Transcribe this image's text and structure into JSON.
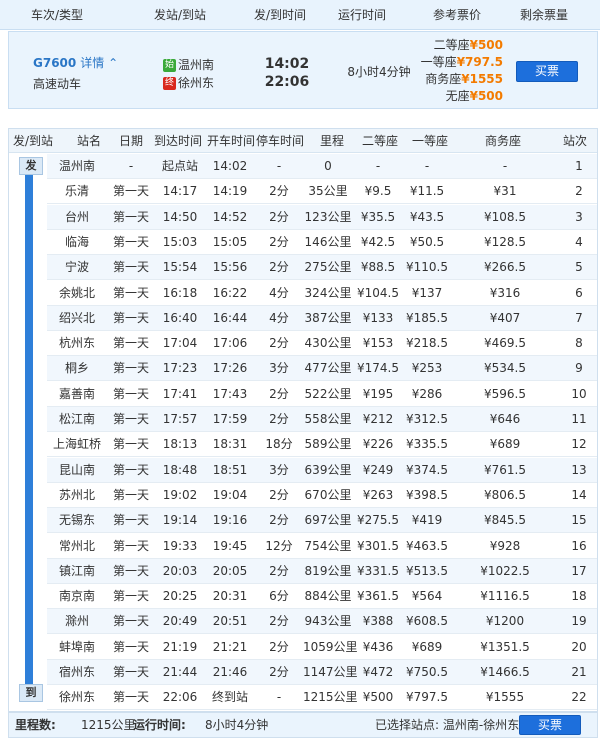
{
  "header": {
    "cols": [
      "车次/类型",
      "发站/到站",
      "发/到时间",
      "运行时间",
      "参考票价",
      "剩余票量"
    ]
  },
  "train": {
    "number": "G7600",
    "detail_link": "详情",
    "type": "高速动车",
    "from_tag": "始",
    "from": "温州南",
    "to_tag": "终",
    "to": "徐州东",
    "depart": "14:02",
    "arrive": "22:06",
    "duration": "8小时4分钟",
    "prices": [
      {
        "label": "二等座",
        "value": "¥500"
      },
      {
        "label": "一等座",
        "value": "¥797.5"
      },
      {
        "label": "商务座",
        "value": "¥1555"
      },
      {
        "label": "无座",
        "value": "¥500"
      }
    ],
    "buy": "买票",
    "tag_colors": {
      "from": "#3aa93a",
      "to": "#d9281e"
    }
  },
  "table": {
    "headers": [
      "发/到站",
      "站名",
      "日期",
      "到达时间",
      "开车时间",
      "停车时间",
      "里程",
      "二等座",
      "一等座",
      "商务座",
      "站次"
    ],
    "depart_badge": "发",
    "arrive_badge": "到",
    "rows": [
      [
        "温州南",
        "-",
        "起点站",
        "14:02",
        "-",
        "0",
        "-",
        "-",
        "-",
        "1"
      ],
      [
        "乐清",
        "第一天",
        "14:17",
        "14:19",
        "2分",
        "35公里",
        "¥9.5",
        "¥11.5",
        "¥31",
        "2"
      ],
      [
        "台州",
        "第一天",
        "14:50",
        "14:52",
        "2分",
        "123公里",
        "¥35.5",
        "¥43.5",
        "¥108.5",
        "3"
      ],
      [
        "临海",
        "第一天",
        "15:03",
        "15:05",
        "2分",
        "146公里",
        "¥42.5",
        "¥50.5",
        "¥128.5",
        "4"
      ],
      [
        "宁波",
        "第一天",
        "15:54",
        "15:56",
        "2分",
        "275公里",
        "¥88.5",
        "¥110.5",
        "¥266.5",
        "5"
      ],
      [
        "余姚北",
        "第一天",
        "16:18",
        "16:22",
        "4分",
        "324公里",
        "¥104.5",
        "¥137",
        "¥316",
        "6"
      ],
      [
        "绍兴北",
        "第一天",
        "16:40",
        "16:44",
        "4分",
        "387公里",
        "¥133",
        "¥185.5",
        "¥407",
        "7"
      ],
      [
        "杭州东",
        "第一天",
        "17:04",
        "17:06",
        "2分",
        "430公里",
        "¥153",
        "¥218.5",
        "¥469.5",
        "8"
      ],
      [
        "桐乡",
        "第一天",
        "17:23",
        "17:26",
        "3分",
        "477公里",
        "¥174.5",
        "¥253",
        "¥534.5",
        "9"
      ],
      [
        "嘉善南",
        "第一天",
        "17:41",
        "17:43",
        "2分",
        "522公里",
        "¥195",
        "¥286",
        "¥596.5",
        "10"
      ],
      [
        "松江南",
        "第一天",
        "17:57",
        "17:59",
        "2分",
        "558公里",
        "¥212",
        "¥312.5",
        "¥646",
        "11"
      ],
      [
        "上海虹桥",
        "第一天",
        "18:13",
        "18:31",
        "18分",
        "589公里",
        "¥226",
        "¥335.5",
        "¥689",
        "12"
      ],
      [
        "昆山南",
        "第一天",
        "18:48",
        "18:51",
        "3分",
        "639公里",
        "¥249",
        "¥374.5",
        "¥761.5",
        "13"
      ],
      [
        "苏州北",
        "第一天",
        "19:02",
        "19:04",
        "2分",
        "670公里",
        "¥263",
        "¥398.5",
        "¥806.5",
        "14"
      ],
      [
        "无锡东",
        "第一天",
        "19:14",
        "19:16",
        "2分",
        "697公里",
        "¥275.5",
        "¥419",
        "¥845.5",
        "15"
      ],
      [
        "常州北",
        "第一天",
        "19:33",
        "19:45",
        "12分",
        "754公里",
        "¥301.5",
        "¥463.5",
        "¥928",
        "16"
      ],
      [
        "镇江南",
        "第一天",
        "20:03",
        "20:05",
        "2分",
        "819公里",
        "¥331.5",
        "¥513.5",
        "¥1022.5",
        "17"
      ],
      [
        "南京南",
        "第一天",
        "20:25",
        "20:31",
        "6分",
        "884公里",
        "¥361.5",
        "¥564",
        "¥1116.5",
        "18"
      ],
      [
        "滁州",
        "第一天",
        "20:49",
        "20:51",
        "2分",
        "943公里",
        "¥388",
        "¥608.5",
        "¥1200",
        "19"
      ],
      [
        "蚌埠南",
        "第一天",
        "21:19",
        "21:21",
        "2分",
        "1059公里",
        "¥436",
        "¥689",
        "¥1351.5",
        "20"
      ],
      [
        "宿州东",
        "第一天",
        "21:44",
        "21:46",
        "2分",
        "1147公里",
        "¥472",
        "¥750.5",
        "¥1466.5",
        "21"
      ],
      [
        "徐州东",
        "第一天",
        "22:06",
        "终到站",
        "-",
        "1215公里",
        "¥500",
        "¥797.5",
        "¥1555",
        "22"
      ]
    ]
  },
  "footer": {
    "distance_label": "里程数:",
    "distance": "1215公里",
    "runtime_label": "运行时间:",
    "runtime": "8小时4分钟",
    "selected": "已选择站点: 温州南-徐州东",
    "buy": "买票"
  }
}
